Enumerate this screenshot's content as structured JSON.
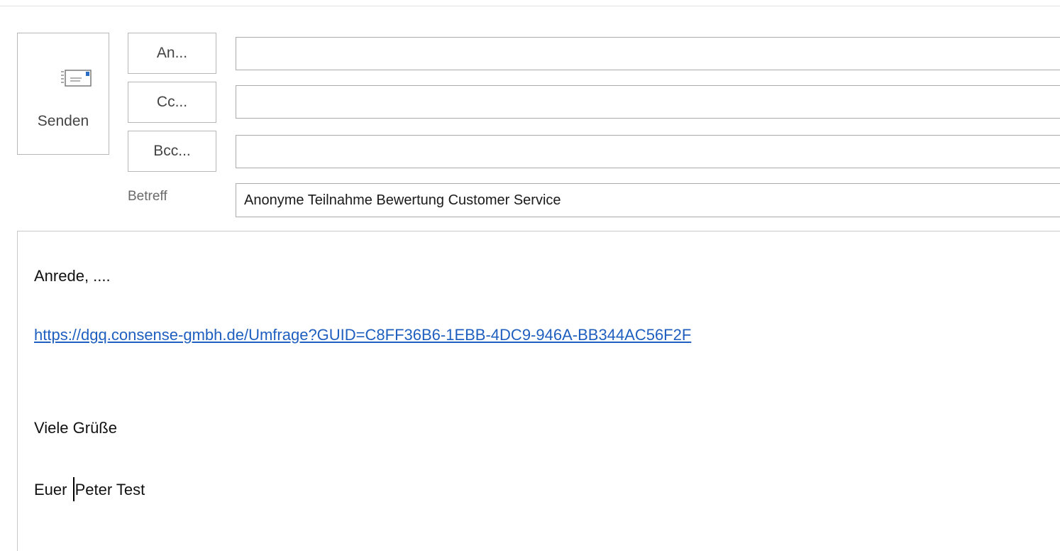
{
  "compose": {
    "send_label": "Senden",
    "to_button": "An...",
    "cc_button": "Cc...",
    "bcc_button": "Bcc...",
    "to_value": "",
    "cc_value": "",
    "bcc_value": "",
    "subject_label": "Betreff",
    "subject_value": "Anonyme Teilnahme Bewertung Customer Service"
  },
  "body": {
    "greeting": "Anrede, ....",
    "link": "https://dgq.consense-gmbh.de/Umfrage?GUID=C8FF36B6-1EBB-4DC9-946A-BB344AC56F2F",
    "closing": "Viele Grüße",
    "signature_before_cursor": "Euer ",
    "signature_after_cursor": "Peter Test"
  },
  "icons": {
    "send": "send-envelope-icon"
  },
  "colors": {
    "link": "#1f5fbf",
    "border": "#b7b7b7",
    "envelope_flag": "#2b6cc4"
  }
}
